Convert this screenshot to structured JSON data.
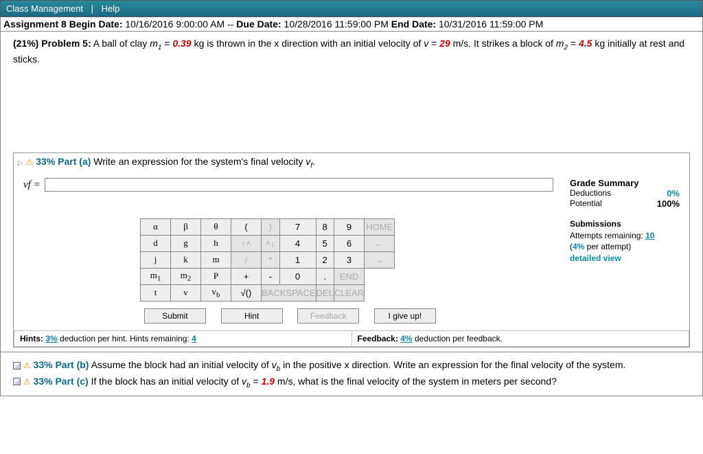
{
  "header": {
    "class_mgmt": "Class Management",
    "sep": "|",
    "help": "Help"
  },
  "assignment": {
    "title": "Assignment 8",
    "begin_label": "Begin Date:",
    "begin": "10/16/2016 9:00:00 AM",
    "sep": "--",
    "due_label": "Due Date:",
    "due": "10/28/2016 11:59:00 PM",
    "end_label": "End Date:",
    "end": "10/31/2016 11:59:00 PM"
  },
  "problem": {
    "weight": "(21%)",
    "label": "Problem 5:",
    "t1": "A ball of clay ",
    "m1v": "m",
    "m1s": "1",
    "eq1": " = ",
    "m1": "0.39",
    "t2": " kg is thrown in the x direction with an initial velocity of ",
    "vv": "v",
    "eq2": " = ",
    "v": "29",
    "t3": " m/s. It strikes a block of ",
    "m2v": "m",
    "m2s": "2",
    "eq3": " = ",
    "m2": "4.5",
    "t4": " kg initially at rest and sticks."
  },
  "part_a": {
    "pct": "33%",
    "label": "Part (a)",
    "prompt": "Write an expression for the system's final velocity ",
    "vfv": "v",
    "vfs": "f",
    "dot": ".",
    "vf_eq": "vf ="
  },
  "grade": {
    "title": "Grade Summary",
    "ded_l": "Deductions",
    "ded_v": "0%",
    "pot_l": "Potential",
    "pot_v": "100%"
  },
  "subm": {
    "title": "Submissions",
    "att_l": "Attempts remaining:",
    "att_v": "10",
    "per": "(4% per attempt)",
    "detail": "detailed view"
  },
  "keys": {
    "r0": [
      "α",
      "β",
      "θ"
    ],
    "r0b": [
      "(",
      ")",
      "7",
      "8",
      "9",
      "HOME"
    ],
    "r1": [
      "d",
      "g",
      "h"
    ],
    "r1b": [
      "↑˄",
      "˄↓",
      "4",
      "5",
      "6",
      "←"
    ],
    "r2": [
      "j",
      "k",
      "m"
    ],
    "r2b": [
      "/",
      "*",
      "1",
      "2",
      "3",
      "→"
    ],
    "r3": [
      "m1",
      "m2",
      "P"
    ],
    "r3b": [
      "+",
      "-",
      "0",
      ".",
      "END"
    ],
    "r4": [
      "t",
      "v",
      "vb"
    ],
    "r4b": [
      "√()",
      "BACKSPACE",
      "DEL",
      "CLEAR"
    ]
  },
  "actions": {
    "submit": "Submit",
    "hint": "Hint",
    "feedback": "Feedback",
    "giveup": "I give up!"
  },
  "hints": {
    "l1a": "Hints: ",
    "l1b": "3%",
    "l1c": " deduction per hint. Hints remaining: ",
    "l1d": "4",
    "r1a": "Feedback: ",
    "r1b": "4%",
    "r1c": " deduction per feedback."
  },
  "part_b": {
    "pct": "33%",
    "label": "Part (b)",
    "t1": "Assume the block had an initial velocity of ",
    "vbv": "v",
    "vbs": "b",
    "t2": " in the positive x direction. Write an expression for the final velocity of the system."
  },
  "part_c": {
    "pct": "33%",
    "label": "Part (c)",
    "t1": "If the block has an initial velocity of ",
    "vbv": "v",
    "vbs": "b",
    "eq": " = ",
    "vb": "1.9",
    "t2": " m/s, what is the final velocity of the system in meters per second?"
  }
}
